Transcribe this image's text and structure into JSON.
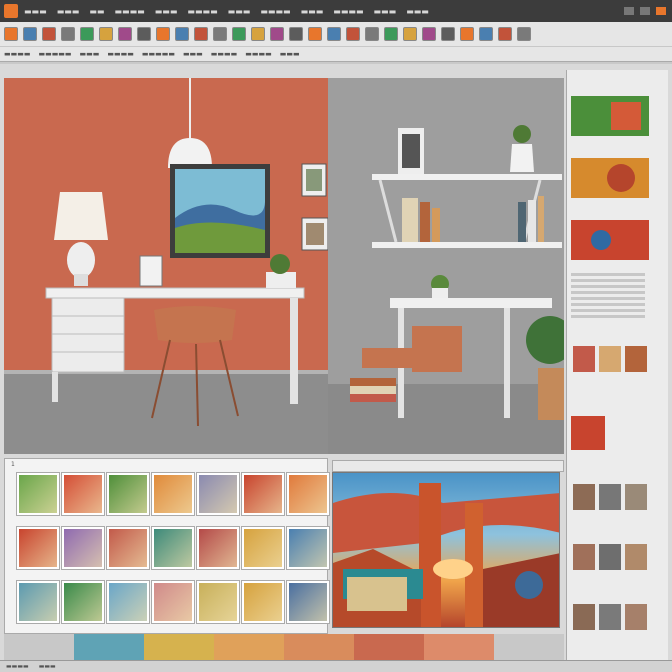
{
  "colors": {
    "accent": "#e8762c",
    "left_wall": "#c9694f",
    "right_wall": "#9e9e9e",
    "swatch_1": "#c8c8c8",
    "swatch_2": "#5fa3b5",
    "swatch_3": "#d6b24e",
    "swatch_4": "#e0a15a",
    "swatch_5": "#d98c5c",
    "swatch_6": "#c9694f",
    "swatch_7": "#dd8b6a",
    "swatch_8": "#c8c8c8"
  },
  "toolbar": {
    "buttons": [
      "tool-1-icon",
      "tool-2-icon",
      "tool-3-icon",
      "tool-4-icon",
      "tool-5-icon",
      "tool-6-icon",
      "tool-7-icon",
      "tool-8-icon",
      "tool-9-icon",
      "tool-10-icon",
      "tool-11-icon",
      "tool-12-icon",
      "tool-13-icon",
      "tool-14-icon",
      "tool-15-icon",
      "tool-16-icon",
      "tool-17-icon",
      "tool-18-icon",
      "tool-19-icon",
      "tool-20-icon",
      "tool-21-icon",
      "tool-22-icon",
      "tool-23-icon",
      "tool-24-icon",
      "tool-25-icon",
      "tool-26-icon",
      "tool-27-icon",
      "tool-28-icon"
    ]
  },
  "thumb_grid": {
    "label": "1"
  }
}
